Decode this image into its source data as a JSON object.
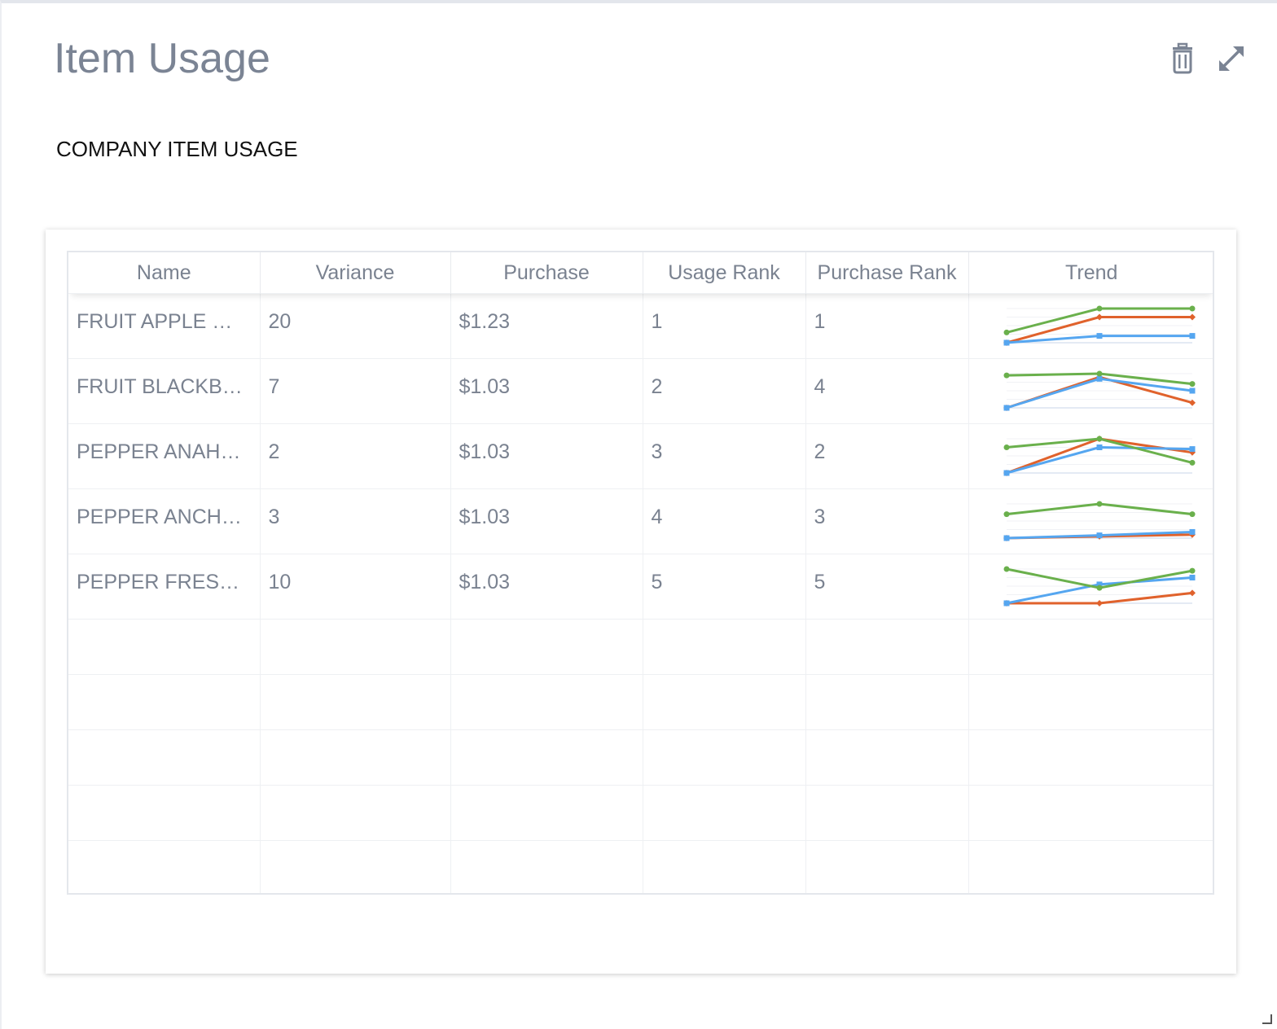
{
  "widget": {
    "title": "Item Usage",
    "subtitle": "COMPANY ITEM USAGE",
    "icons": [
      "trash-icon",
      "expand-icon"
    ]
  },
  "table": {
    "columns": [
      "Name",
      "Variance",
      "Purchase",
      "Usage Rank",
      "Purchase Rank",
      "Trend"
    ],
    "rows": [
      {
        "name": "FRUIT APPLE …",
        "variance": "20",
        "purchase": "$1.23",
        "usage_rank": "1",
        "purchase_rank": "1"
      },
      {
        "name": "FRUIT BLACKB…",
        "variance": "7",
        "purchase": "$1.03",
        "usage_rank": "2",
        "purchase_rank": "4"
      },
      {
        "name": "PEPPER ANAH…",
        "variance": "2",
        "purchase": "$1.03",
        "usage_rank": "3",
        "purchase_rank": "2"
      },
      {
        "name": "PEPPER ANCH…",
        "variance": "3",
        "purchase": "$1.03",
        "usage_rank": "4",
        "purchase_rank": "3"
      },
      {
        "name": "PEPPER FRES…",
        "variance": "10",
        "purchase": "$1.03",
        "usage_rank": "5",
        "purchase_rank": "5"
      }
    ],
    "empty_rows": 5
  },
  "trend_colors": {
    "green": "#6ab04c",
    "orange": "#e0622c",
    "blue": "#55a6f0"
  },
  "trends": [
    {
      "green": [
        0.3,
        1.0,
        1.0
      ],
      "orange": [
        0.0,
        0.75,
        0.75
      ],
      "blue": [
        0.0,
        0.2,
        0.2
      ]
    },
    {
      "green": [
        0.95,
        1.0,
        0.7
      ],
      "orange": [
        0.0,
        0.9,
        0.15
      ],
      "blue": [
        0.0,
        0.85,
        0.5
      ]
    },
    {
      "green": [
        0.75,
        1.0,
        0.3
      ],
      "orange": [
        0.0,
        1.0,
        0.6
      ],
      "blue": [
        0.0,
        0.75,
        0.7
      ]
    },
    {
      "green": [
        0.7,
        1.0,
        0.7
      ],
      "orange": [
        0.0,
        0.05,
        0.1
      ],
      "blue": [
        0.0,
        0.08,
        0.18
      ]
    },
    {
      "green": [
        1.0,
        0.45,
        0.95
      ],
      "orange": [
        0.0,
        0.0,
        0.3
      ],
      "blue": [
        0.0,
        0.55,
        0.75
      ]
    }
  ]
}
